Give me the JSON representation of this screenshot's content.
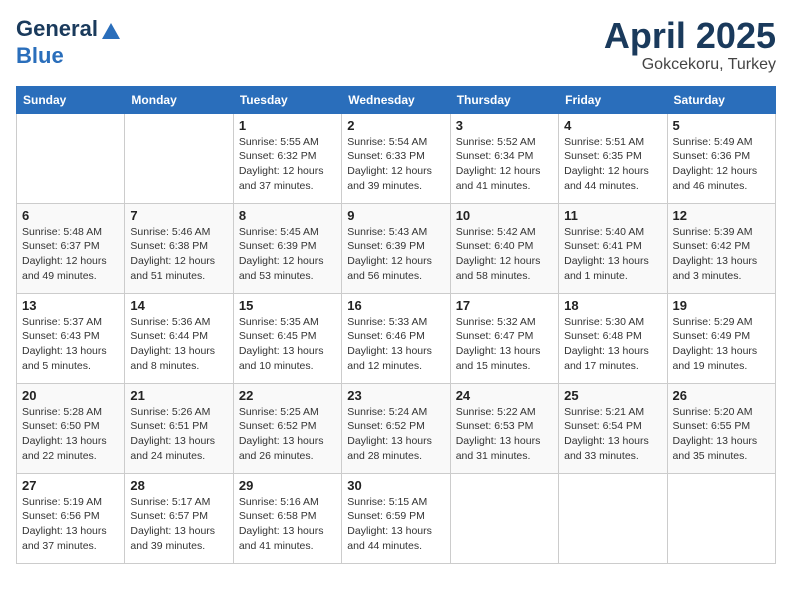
{
  "header": {
    "logo_line1": "General",
    "logo_line2": "Blue",
    "title": "April 2025",
    "subtitle": "Gokcekoru, Turkey"
  },
  "calendar": {
    "weekdays": [
      "Sunday",
      "Monday",
      "Tuesday",
      "Wednesday",
      "Thursday",
      "Friday",
      "Saturday"
    ],
    "weeks": [
      [
        {
          "day": null,
          "info": null
        },
        {
          "day": null,
          "info": null
        },
        {
          "day": "1",
          "info": "Sunrise: 5:55 AM\nSunset: 6:32 PM\nDaylight: 12 hours and 37 minutes."
        },
        {
          "day": "2",
          "info": "Sunrise: 5:54 AM\nSunset: 6:33 PM\nDaylight: 12 hours and 39 minutes."
        },
        {
          "day": "3",
          "info": "Sunrise: 5:52 AM\nSunset: 6:34 PM\nDaylight: 12 hours and 41 minutes."
        },
        {
          "day": "4",
          "info": "Sunrise: 5:51 AM\nSunset: 6:35 PM\nDaylight: 12 hours and 44 minutes."
        },
        {
          "day": "5",
          "info": "Sunrise: 5:49 AM\nSunset: 6:36 PM\nDaylight: 12 hours and 46 minutes."
        }
      ],
      [
        {
          "day": "6",
          "info": "Sunrise: 5:48 AM\nSunset: 6:37 PM\nDaylight: 12 hours and 49 minutes."
        },
        {
          "day": "7",
          "info": "Sunrise: 5:46 AM\nSunset: 6:38 PM\nDaylight: 12 hours and 51 minutes."
        },
        {
          "day": "8",
          "info": "Sunrise: 5:45 AM\nSunset: 6:39 PM\nDaylight: 12 hours and 53 minutes."
        },
        {
          "day": "9",
          "info": "Sunrise: 5:43 AM\nSunset: 6:39 PM\nDaylight: 12 hours and 56 minutes."
        },
        {
          "day": "10",
          "info": "Sunrise: 5:42 AM\nSunset: 6:40 PM\nDaylight: 12 hours and 58 minutes."
        },
        {
          "day": "11",
          "info": "Sunrise: 5:40 AM\nSunset: 6:41 PM\nDaylight: 13 hours and 1 minute."
        },
        {
          "day": "12",
          "info": "Sunrise: 5:39 AM\nSunset: 6:42 PM\nDaylight: 13 hours and 3 minutes."
        }
      ],
      [
        {
          "day": "13",
          "info": "Sunrise: 5:37 AM\nSunset: 6:43 PM\nDaylight: 13 hours and 5 minutes."
        },
        {
          "day": "14",
          "info": "Sunrise: 5:36 AM\nSunset: 6:44 PM\nDaylight: 13 hours and 8 minutes."
        },
        {
          "day": "15",
          "info": "Sunrise: 5:35 AM\nSunset: 6:45 PM\nDaylight: 13 hours and 10 minutes."
        },
        {
          "day": "16",
          "info": "Sunrise: 5:33 AM\nSunset: 6:46 PM\nDaylight: 13 hours and 12 minutes."
        },
        {
          "day": "17",
          "info": "Sunrise: 5:32 AM\nSunset: 6:47 PM\nDaylight: 13 hours and 15 minutes."
        },
        {
          "day": "18",
          "info": "Sunrise: 5:30 AM\nSunset: 6:48 PM\nDaylight: 13 hours and 17 minutes."
        },
        {
          "day": "19",
          "info": "Sunrise: 5:29 AM\nSunset: 6:49 PM\nDaylight: 13 hours and 19 minutes."
        }
      ],
      [
        {
          "day": "20",
          "info": "Sunrise: 5:28 AM\nSunset: 6:50 PM\nDaylight: 13 hours and 22 minutes."
        },
        {
          "day": "21",
          "info": "Sunrise: 5:26 AM\nSunset: 6:51 PM\nDaylight: 13 hours and 24 minutes."
        },
        {
          "day": "22",
          "info": "Sunrise: 5:25 AM\nSunset: 6:52 PM\nDaylight: 13 hours and 26 minutes."
        },
        {
          "day": "23",
          "info": "Sunrise: 5:24 AM\nSunset: 6:52 PM\nDaylight: 13 hours and 28 minutes."
        },
        {
          "day": "24",
          "info": "Sunrise: 5:22 AM\nSunset: 6:53 PM\nDaylight: 13 hours and 31 minutes."
        },
        {
          "day": "25",
          "info": "Sunrise: 5:21 AM\nSunset: 6:54 PM\nDaylight: 13 hours and 33 minutes."
        },
        {
          "day": "26",
          "info": "Sunrise: 5:20 AM\nSunset: 6:55 PM\nDaylight: 13 hours and 35 minutes."
        }
      ],
      [
        {
          "day": "27",
          "info": "Sunrise: 5:19 AM\nSunset: 6:56 PM\nDaylight: 13 hours and 37 minutes."
        },
        {
          "day": "28",
          "info": "Sunrise: 5:17 AM\nSunset: 6:57 PM\nDaylight: 13 hours and 39 minutes."
        },
        {
          "day": "29",
          "info": "Sunrise: 5:16 AM\nSunset: 6:58 PM\nDaylight: 13 hours and 41 minutes."
        },
        {
          "day": "30",
          "info": "Sunrise: 5:15 AM\nSunset: 6:59 PM\nDaylight: 13 hours and 44 minutes."
        },
        {
          "day": null,
          "info": null
        },
        {
          "day": null,
          "info": null
        },
        {
          "day": null,
          "info": null
        }
      ]
    ]
  }
}
